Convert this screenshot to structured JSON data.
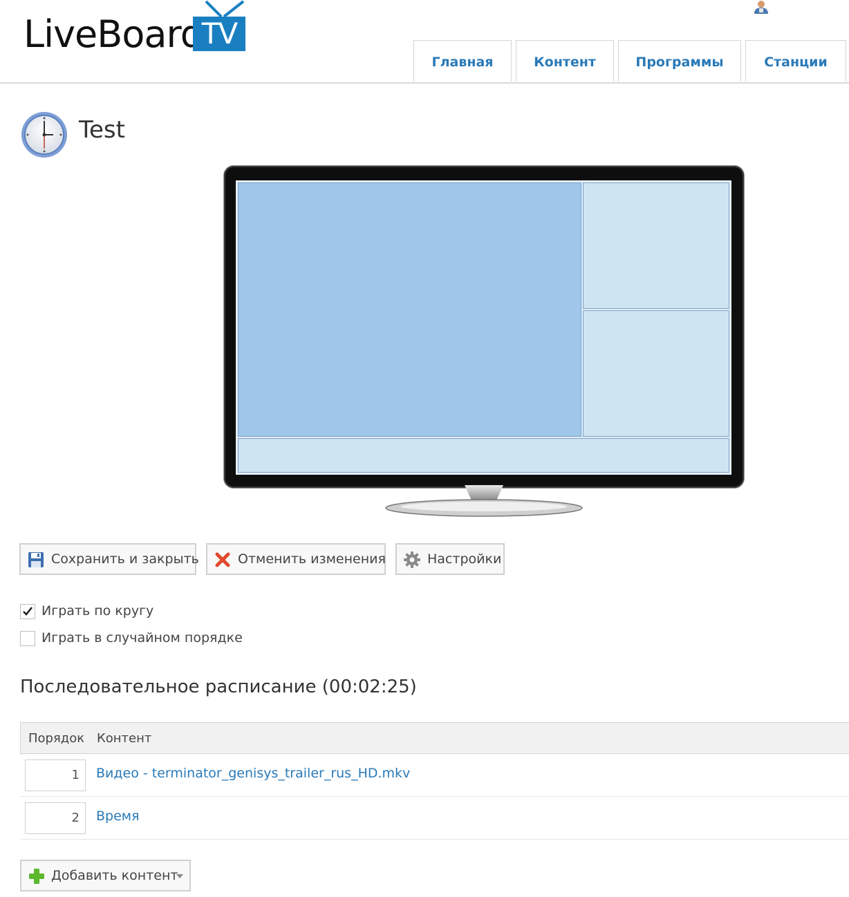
{
  "brand": {
    "name": "LiveBoard",
    "tv": "TV",
    "accent": "#1a7fc1"
  },
  "nav": {
    "tabs": [
      {
        "label": "Главная"
      },
      {
        "label": "Контент"
      },
      {
        "label": "Программы"
      },
      {
        "label": "Станции"
      }
    ],
    "link_color": "#2a7ab8"
  },
  "page": {
    "title": "Test",
    "icon": "clock-icon"
  },
  "screen": {
    "zones": [
      "main",
      "top-right",
      "bottom-right",
      "bottom-strip"
    ],
    "main_color": "#a0c6ea",
    "secondary_color": "#cfe4f3"
  },
  "toolbar": {
    "save_label": "Сохранить и закрыть",
    "cancel_label": "Отменить изменения",
    "settings_label": "Настройки"
  },
  "options": {
    "loop": {
      "label": "Играть по кругу",
      "checked": true
    },
    "shuffle": {
      "label": "Играть в случайном порядке",
      "checked": false
    }
  },
  "schedule": {
    "title": "Последовательное расписание (00:02:25)",
    "columns": {
      "order": "Порядок",
      "content": "Контент"
    },
    "rows": [
      {
        "order": "1",
        "content": "Видео - terminator_genisys_trailer_rus_HD.mkv"
      },
      {
        "order": "2",
        "content": "Время"
      }
    ],
    "add_label": "Добавить контент"
  }
}
